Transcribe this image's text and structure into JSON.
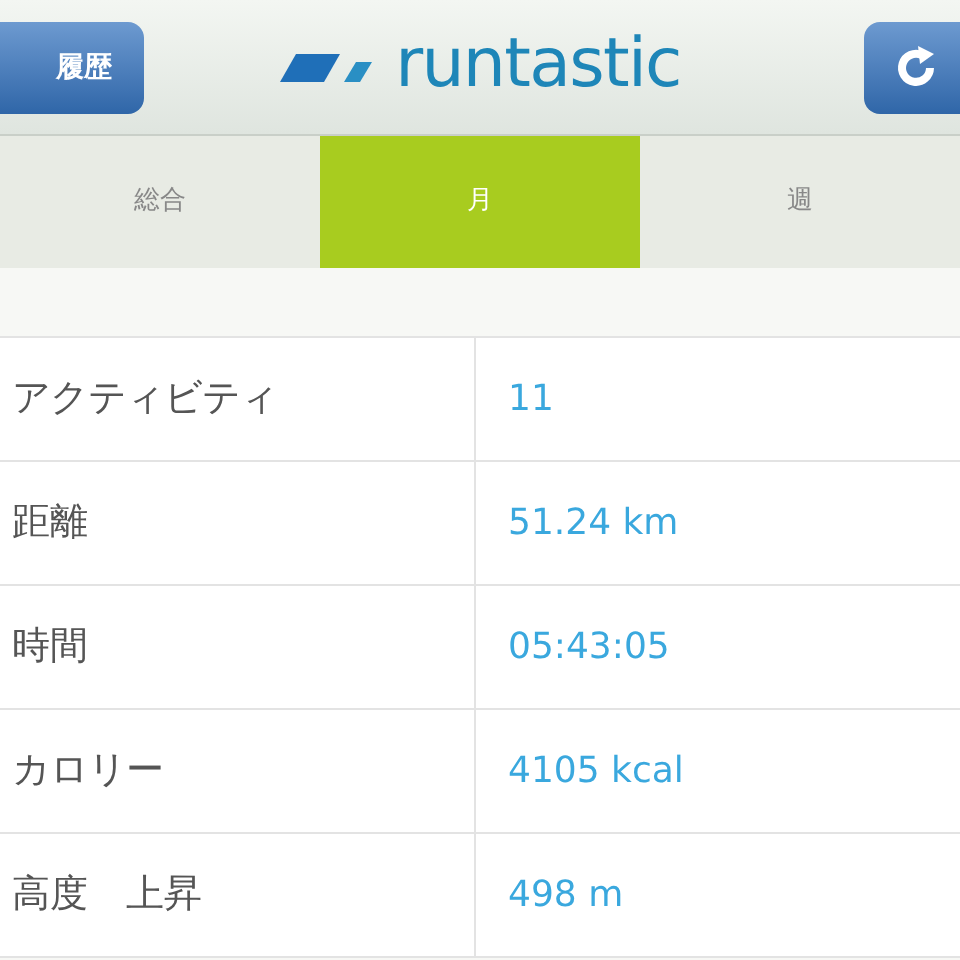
{
  "header": {
    "back_button": "履歴",
    "logo": "runtastic"
  },
  "tabs": [
    {
      "label": "総合",
      "selected": false
    },
    {
      "label": "月",
      "selected": true
    },
    {
      "label": "週",
      "selected": false
    }
  ],
  "stats": [
    {
      "label": "アクティビティ",
      "value": "11"
    },
    {
      "label": "距離",
      "value": "51.24 km"
    },
    {
      "label": "時間",
      "value": "05:43:05"
    },
    {
      "label": "カロリー",
      "value": "4105 kcal"
    },
    {
      "label": "高度　上昇",
      "value": "498 m"
    }
  ]
}
